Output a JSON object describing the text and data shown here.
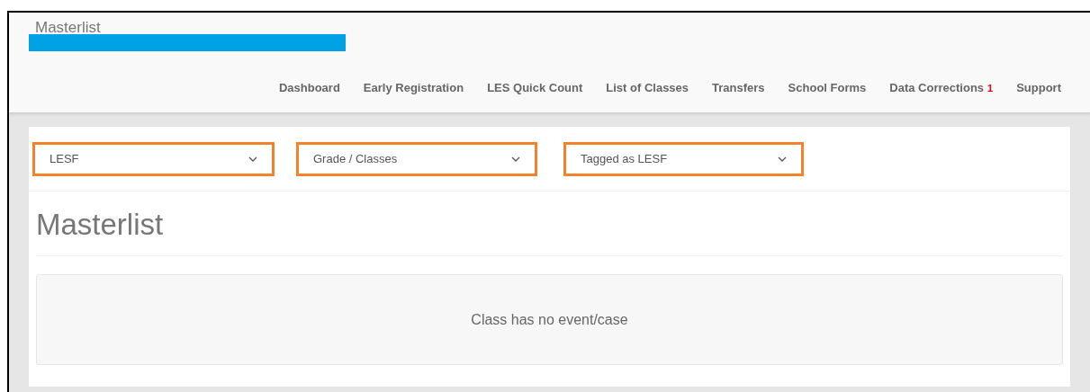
{
  "header": {
    "title": "Masterlist"
  },
  "nav": [
    {
      "label": "Dashboard"
    },
    {
      "label": "Early Registration"
    },
    {
      "label": "LES Quick Count"
    },
    {
      "label": "List of Classes"
    },
    {
      "label": "Transfers"
    },
    {
      "label": "School Forms"
    },
    {
      "label": "Data Corrections",
      "badge": "1"
    },
    {
      "label": "Support"
    }
  ],
  "filters": [
    {
      "value": "LESF"
    },
    {
      "value": "Grade / Classes"
    },
    {
      "value": "Tagged as LESF"
    }
  ],
  "page_title": "Masterlist",
  "empty_message": "Class has no event/case"
}
